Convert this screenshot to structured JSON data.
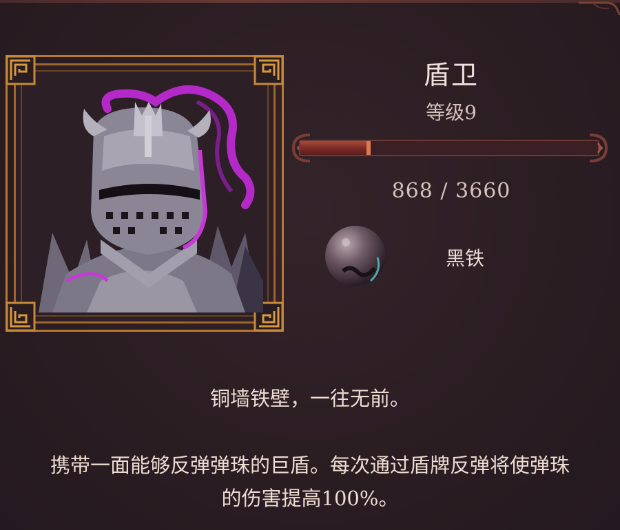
{
  "hero": {
    "name": "盾卫",
    "level_label": "等级9",
    "portrait_icon": "armored-knight-portrait",
    "xp": {
      "current": 868,
      "max": 3660,
      "text": "868 / 3660"
    },
    "material": {
      "icon": "black-iron-orb-icon",
      "name": "黑铁"
    },
    "tagline": "铜墙铁壁，一往无前。",
    "description_line1": "携带一面能够反弹弹珠的巨盾。每次通过盾牌反弹将使弹珠",
    "description_line2": "的伤害提高100%。"
  },
  "colors": {
    "background": "#2a1d22",
    "frame_gold": "#b8782e",
    "xp_fill": "#8a3430",
    "text": "#ecdcd2",
    "accent_purple": "#b42ac8"
  }
}
